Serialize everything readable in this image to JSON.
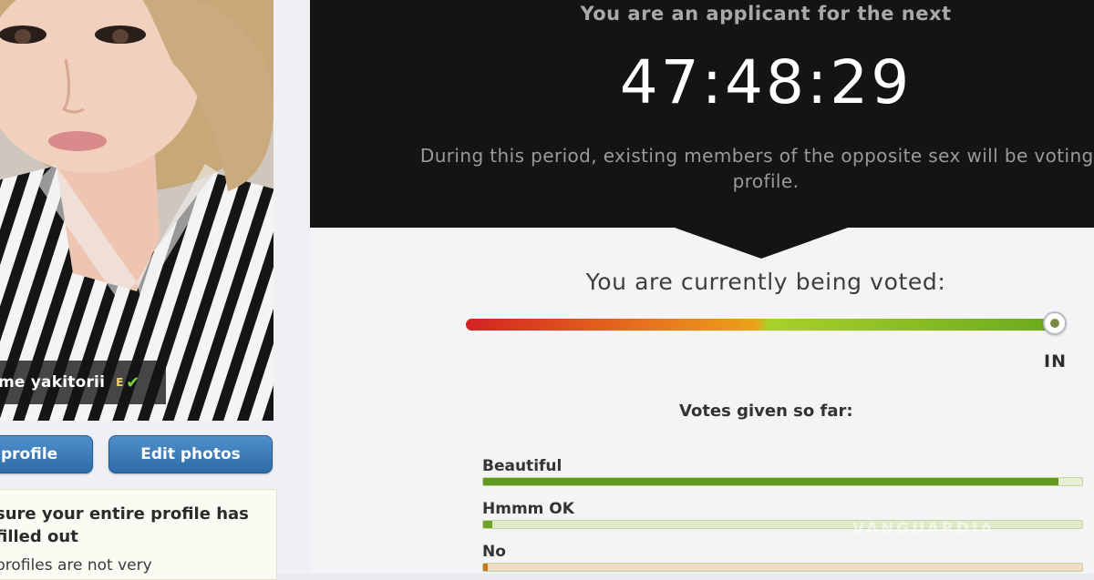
{
  "profile": {
    "name": "me yakitorii",
    "verify_badge": "E",
    "check_glyph": "✔",
    "photo_subject": "portrait-photo",
    "buttons": {
      "profile_label": "profile",
      "edit_photos_label": "Edit photos"
    },
    "tip": {
      "title": "sure your entire profile has\nfilled out",
      "body": " profiles are not very"
    }
  },
  "applicant": {
    "intro": "You are an applicant for the next",
    "countdown": "47:48:29",
    "period_line1": "During this period, existing members of the opposite sex will be voting o",
    "period_line2": "profile."
  },
  "voting": {
    "heading": "You are currently being voted:",
    "meter_level": 1.0,
    "status": "IN",
    "votes_heading": "Votes given so far:",
    "vote_bars": [
      {
        "label": "Beautiful",
        "fraction": 0.96,
        "fill_color": "#5f9a1f",
        "track_color": "#e6efd4"
      },
      {
        "label": "Hmmm OK",
        "fraction": 0.015,
        "fill_color": "#6ea126",
        "track_color": "#e1ebcc"
      },
      {
        "label": "No",
        "fraction": 0.005,
        "fill_color": "#c9791d",
        "track_color": "#efdcc5"
      }
    ]
  },
  "watermark": "VANGUARDIA",
  "colors": {
    "timer_bg": "#141414",
    "button_blue": "#3a7bbb",
    "meter_red": "#d22222",
    "meter_green": "#6aa91b"
  }
}
